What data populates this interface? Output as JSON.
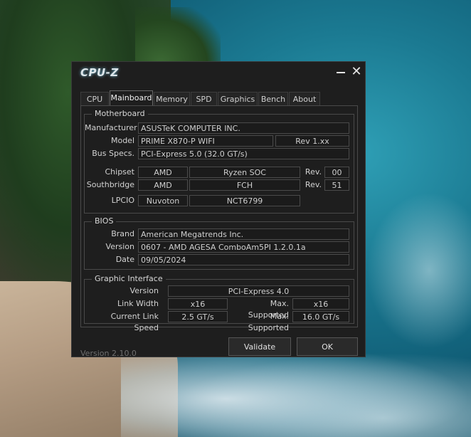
{
  "app": {
    "title": "CPU-Z",
    "version": "Version 2.10.0"
  },
  "tabs": [
    "CPU",
    "Mainboard",
    "Memory",
    "SPD",
    "Graphics",
    "Bench",
    "About"
  ],
  "active_tab": "Mainboard",
  "motherboard": {
    "legend": "Motherboard",
    "manufacturer_label": "Manufacturer",
    "manufacturer": "ASUSTeK COMPUTER INC.",
    "model_label": "Model",
    "model": "PRIME X870-P WIFI",
    "model_rev": "Rev 1.xx",
    "bus_label": "Bus Specs.",
    "bus": "PCI-Express 5.0 (32.0 GT/s)",
    "chipset_label": "Chipset",
    "chipset_vendor": "AMD",
    "chipset_model": "Ryzen SOC",
    "rev_label": "Rev.",
    "chipset_rev": "00",
    "southbridge_label": "Southbridge",
    "southbridge_vendor": "AMD",
    "southbridge_model": "FCH",
    "southbridge_rev": "51",
    "lpcio_label": "LPCIO",
    "lpcio_vendor": "Nuvoton",
    "lpcio_model": "NCT6799"
  },
  "bios": {
    "legend": "BIOS",
    "brand_label": "Brand",
    "brand": "American Megatrends Inc.",
    "version_label": "Version",
    "version": "0607 - AMD AGESA ComboAm5PI 1.2.0.1a",
    "date_label": "Date",
    "date": "09/05/2024"
  },
  "graphic_interface": {
    "legend": "Graphic Interface",
    "version_label": "Version",
    "version": "PCI-Express 4.0",
    "link_width_label": "Link Width",
    "link_width": "x16",
    "max_supported_label": "Max. Supported",
    "max_link_width": "x16",
    "link_speed_label": "Current Link Speed",
    "link_speed": "2.5 GT/s",
    "max_link_speed": "16.0 GT/s"
  },
  "buttons": {
    "validate": "Validate",
    "ok": "OK"
  }
}
